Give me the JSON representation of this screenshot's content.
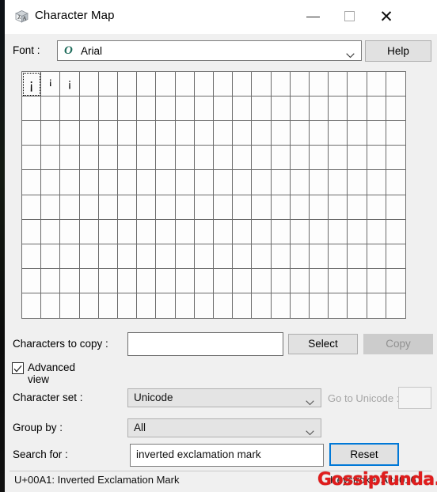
{
  "window": {
    "title": "Character Map",
    "app_icon": "character-map-icon",
    "controls": {
      "minimize": "minimize-icon",
      "maximize": "maximize-icon",
      "close": "close-icon"
    }
  },
  "font_row": {
    "label": "Font :",
    "selected_font": "Arial",
    "font_type_icon": "O",
    "help_label": "Help"
  },
  "grid": {
    "columns": 20,
    "rows": 10,
    "selected_index": 0,
    "cells": [
      {
        "char": "¡",
        "style": "normal"
      },
      {
        "char": "¡",
        "style": "narrow"
      },
      {
        "char": "¡",
        "style": "tiny"
      }
    ]
  },
  "copy_row": {
    "label": "Characters to copy :",
    "value": "",
    "placeholder": "",
    "select_label": "Select",
    "copy_label": "Copy",
    "copy_enabled": false
  },
  "advanced_view": {
    "label": "Advanced view",
    "checked": true
  },
  "charset_row": {
    "label": "Character set :",
    "value": "Unicode",
    "goto_label": "Go to Unicode :",
    "goto_value": "",
    "goto_enabled": false
  },
  "groupby_row": {
    "label": "Group by :",
    "value": "All"
  },
  "search_row": {
    "label": "Search for :",
    "value": "inverted exclamation mark",
    "reset_label": "Reset"
  },
  "statusbar": {
    "left": "U+00A1: Inverted Exclamation Mark",
    "right": "Keystroke: Alt+0161"
  },
  "watermark": {
    "text": "Gossipfunda.com",
    "color": "#e01c1c"
  }
}
